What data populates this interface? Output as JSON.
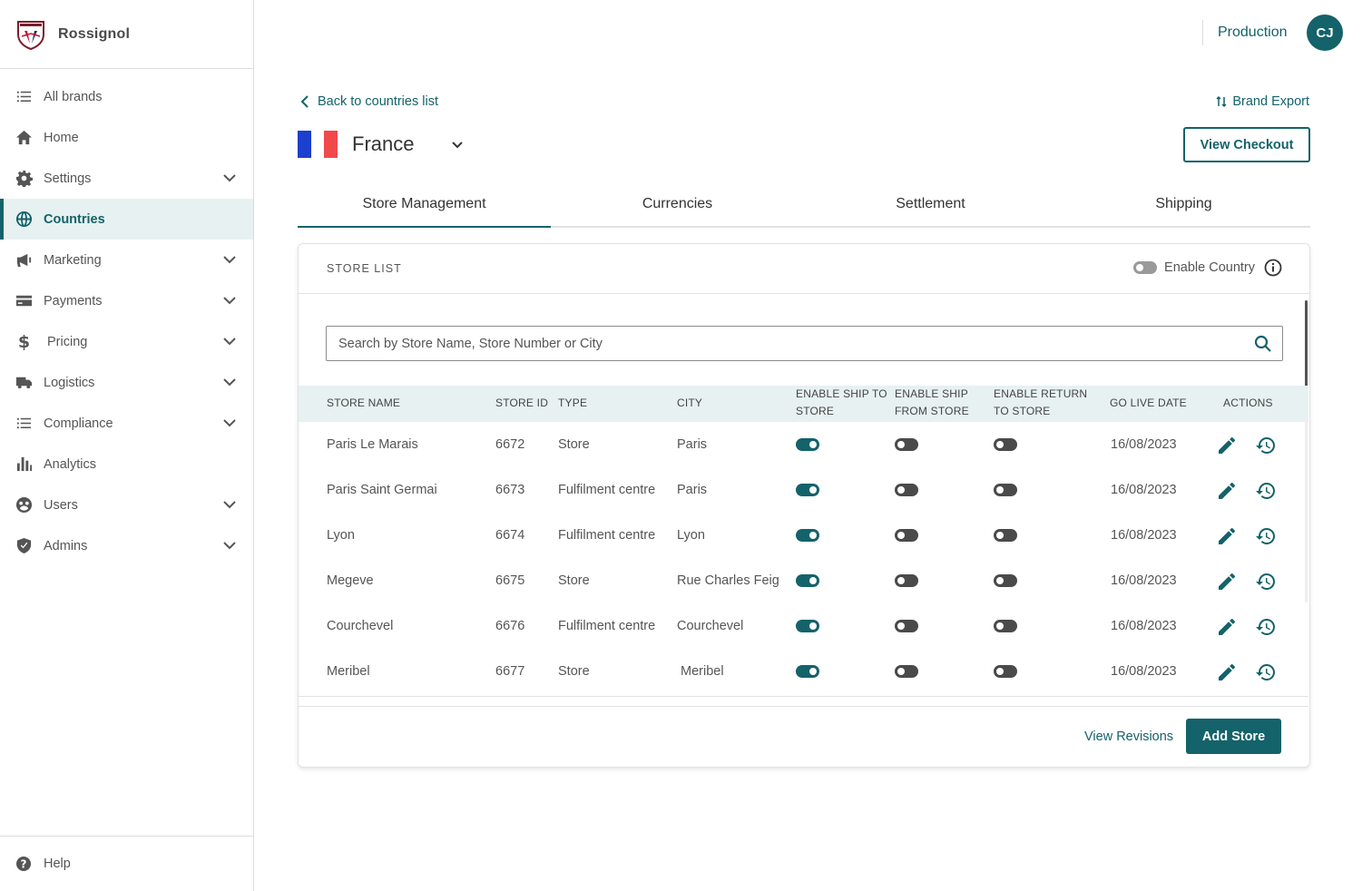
{
  "brand": {
    "name": "Rossignol",
    "logo_text": "ROSSIGNOL"
  },
  "sidebar": {
    "items": [
      {
        "label": "All brands",
        "icon": "list-icon",
        "has_chevron": false,
        "active": false
      },
      {
        "label": "Home",
        "icon": "home-icon",
        "has_chevron": false,
        "active": false
      },
      {
        "label": "Settings",
        "icon": "gear-icon",
        "has_chevron": true,
        "active": false
      },
      {
        "label": "Countries",
        "icon": "globe-icon",
        "has_chevron": false,
        "active": true
      },
      {
        "label": "Marketing",
        "icon": "megaphone-icon",
        "has_chevron": true,
        "active": false
      },
      {
        "label": "Payments",
        "icon": "credit-card-icon",
        "has_chevron": true,
        "active": false
      },
      {
        "label": "Pricing",
        "icon": "dollar-icon",
        "has_chevron": true,
        "active": false
      },
      {
        "label": "Logistics",
        "icon": "truck-icon",
        "has_chevron": true,
        "active": false
      },
      {
        "label": "Compliance",
        "icon": "list-icon",
        "has_chevron": true,
        "active": false
      },
      {
        "label": "Analytics",
        "icon": "bar-chart-icon",
        "has_chevron": false,
        "active": false
      },
      {
        "label": "Users",
        "icon": "users-icon",
        "has_chevron": true,
        "active": false
      },
      {
        "label": "Admins",
        "icon": "shield-icon",
        "has_chevron": true,
        "active": false
      }
    ],
    "help_label": "Help"
  },
  "topbar": {
    "environment": "Production",
    "avatar_initials": "CJ"
  },
  "page": {
    "back_label": "Back to countries list",
    "export_label": "Brand Export",
    "country_name": "France",
    "checkout_label": "View Checkout"
  },
  "tabs": [
    {
      "label": "Store Management",
      "active": true
    },
    {
      "label": "Currencies",
      "active": false
    },
    {
      "label": "Settlement",
      "active": false
    },
    {
      "label": "Shipping",
      "active": false
    }
  ],
  "store_list": {
    "title": "STORE LIST",
    "enable_country_label": "Enable Country",
    "enable_country_on": false,
    "search_placeholder": "Search by Store Name, Store Number or City",
    "columns": {
      "store_name": "STORE NAME",
      "store_id": "STORE ID",
      "type": "TYPE",
      "city": "CITY",
      "ship_to_store_1": "ENABLE SHIP TO",
      "ship_to_store_2": "STORE",
      "ship_from_store_1": "ENABLE SHIP",
      "ship_from_store_2": "FROM STORE",
      "return_to_store_1": "ENABLE RETURN",
      "return_to_store_2": "TO STORE",
      "go_live_date": "GO LIVE DATE",
      "actions": "ACTIONS"
    },
    "rows": [
      {
        "name": "Paris Le Marais",
        "id": "6672",
        "type": "Store",
        "city": "Paris",
        "ship_to": true,
        "ship_from": false,
        "return_to": false,
        "go_live": "16/08/2023"
      },
      {
        "name": "Paris Saint Germai",
        "id": "6673",
        "type": "Fulfilment centre",
        "city": "Paris",
        "ship_to": true,
        "ship_from": false,
        "return_to": false,
        "go_live": "16/08/2023"
      },
      {
        "name": "Lyon",
        "id": "6674",
        "type": "Fulfilment centre",
        "city": "Lyon",
        "ship_to": true,
        "ship_from": false,
        "return_to": false,
        "go_live": "16/08/2023"
      },
      {
        "name": "Megeve",
        "id": "6675",
        "type": "Store",
        "city": "Rue Charles Feig",
        "ship_to": true,
        "ship_from": false,
        "return_to": false,
        "go_live": "16/08/2023"
      },
      {
        "name": "Courchevel",
        "id": "6676",
        "type": "Fulfilment centre",
        "city": "Courchevel",
        "ship_to": true,
        "ship_from": false,
        "return_to": false,
        "go_live": "16/08/2023"
      },
      {
        "name": "Meribel",
        "id": "6677",
        "type": "Store",
        "city": "Meribel",
        "ship_to": true,
        "ship_from": false,
        "return_to": false,
        "go_live": "16/08/2023"
      }
    ],
    "view_revisions_label": "View Revisions",
    "add_store_label": "Add Store"
  },
  "colors": {
    "accent": "#14626a",
    "active_bg": "#e7f1f1",
    "flag_blue": "#1c3fce",
    "flag_white": "#ffffff",
    "flag_red": "#f1484c",
    "switch_off": "#4a4a4a"
  }
}
